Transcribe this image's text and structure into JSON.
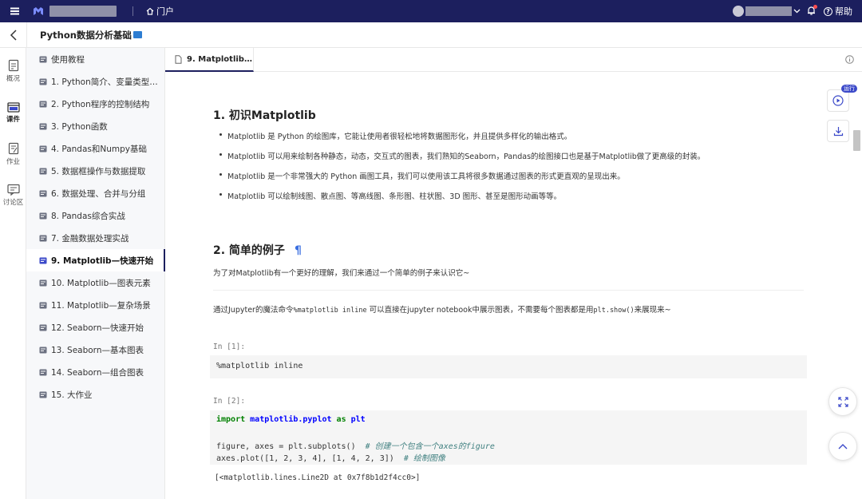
{
  "topbar": {
    "portal_label": "门户",
    "help_label": "帮助"
  },
  "course": {
    "title": "Python数据分析基础"
  },
  "rail": [
    {
      "label": "概况",
      "icon": "overview-icon"
    },
    {
      "label": "课件",
      "icon": "courseware-icon",
      "active": true
    },
    {
      "label": "作业",
      "icon": "homework-icon"
    },
    {
      "label": "讨论区",
      "icon": "discussion-icon"
    }
  ],
  "sidebar": {
    "items": [
      {
        "label": "使用教程"
      },
      {
        "label": "1. Python简介、变量类型及…"
      },
      {
        "label": "2. Python程序的控制结构"
      },
      {
        "label": "3. Python函数"
      },
      {
        "label": "4. Pandas和Numpy基础"
      },
      {
        "label": "5. 数据框操作与数据提取"
      },
      {
        "label": "6. 数据处理、合并与分组"
      },
      {
        "label": "8. Pandas综合实战"
      },
      {
        "label": "7. 金融数据处理实战"
      },
      {
        "label": "9. Matplotlib—快速开始",
        "active": true
      },
      {
        "label": "10. Matplotlib—图表元素"
      },
      {
        "label": "11. Matplotlib—复杂场景"
      },
      {
        "label": "12. Seaborn—快速开始"
      },
      {
        "label": "13. Seaborn—基本图表"
      },
      {
        "label": "14. Seaborn—组合图表"
      },
      {
        "label": "15. 大作业"
      }
    ]
  },
  "tab": {
    "label": "9. Matplotlib…"
  },
  "content": {
    "h1": "1. 初识Matplotlib",
    "bullets": [
      "Matplotlib 是 Python 的绘图库，它能让使用者很轻松地将数据图形化，并且提供多样化的输出格式。",
      "Matplotlib 可以用来绘制各种静态，动态，交互式的图表，我们熟知的Seaborn，Pandas的绘图接口也是基于Matplotlib做了更高级的封装。",
      "Matplotlib 是一个非常强大的 Python 画图工具，我们可以使用该工具将很多数据通过图表的形式更直观的呈现出来。",
      "Matplotlib 可以绘制线图、散点图、等高线图、条形图、柱状图、3D 图形、甚至是图形动画等等。"
    ],
    "h2": "2. 简单的例子",
    "h2_anchor": "¶",
    "intro": "为了对Matplotlib有一个更好的理解，我们来通过一个简单的例子来认识它~",
    "jupyter_pre": "通过Jupyter的魔法命令",
    "jupyter_code1": "%matplotlib inline",
    "jupyter_mid": " 可以直接在jupyter notebook中展示图表，不需要每个图表都是用",
    "jupyter_code2": "plt.show()",
    "jupyter_post": "来展现来~",
    "cell1": {
      "prompt": "In [1]:",
      "code": "%matplotlib inline"
    },
    "cell2": {
      "prompt": "In [2]:",
      "kw_import": "import",
      "module": "matplotlib.pyplot",
      "kw_as": "as",
      "alias": "plt",
      "line2_code": "figure, axes = plt.subplots()  ",
      "line2_comment": "# 创建一个包含一个axes的figure",
      "line3_code": "axes.plot([1, 2, 3, 4], [1, 4, 2, 3])  ",
      "line3_comment": "# 绘制图像",
      "output": "[<matplotlib.lines.Line2D at 0x7f8b1d2f4cc0>]"
    }
  },
  "tools": {
    "run_badge": "运行"
  },
  "colors": {
    "topbar": "#1c1f5e",
    "accent": "#3b49c9",
    "sidebar_bg": "#f7f8fa"
  }
}
